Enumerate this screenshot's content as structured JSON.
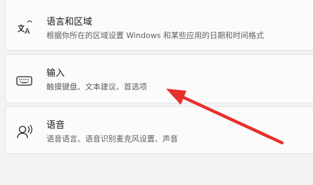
{
  "settings": {
    "items": [
      {
        "title": "语言和区域",
        "description": "根据你所在的区域设置 Windows 和某些应用的日期和时间格式",
        "icon": "language-icon"
      },
      {
        "title": "输入",
        "description": "触摸键盘、文本建议、首选项",
        "icon": "keyboard-icon"
      },
      {
        "title": "语音",
        "description": "语音语言、语音识别麦克风设置、声音",
        "icon": "speech-icon"
      }
    ]
  },
  "annotation": {
    "arrow_color": "#e8302c",
    "icon": "red-arrow-icon"
  }
}
